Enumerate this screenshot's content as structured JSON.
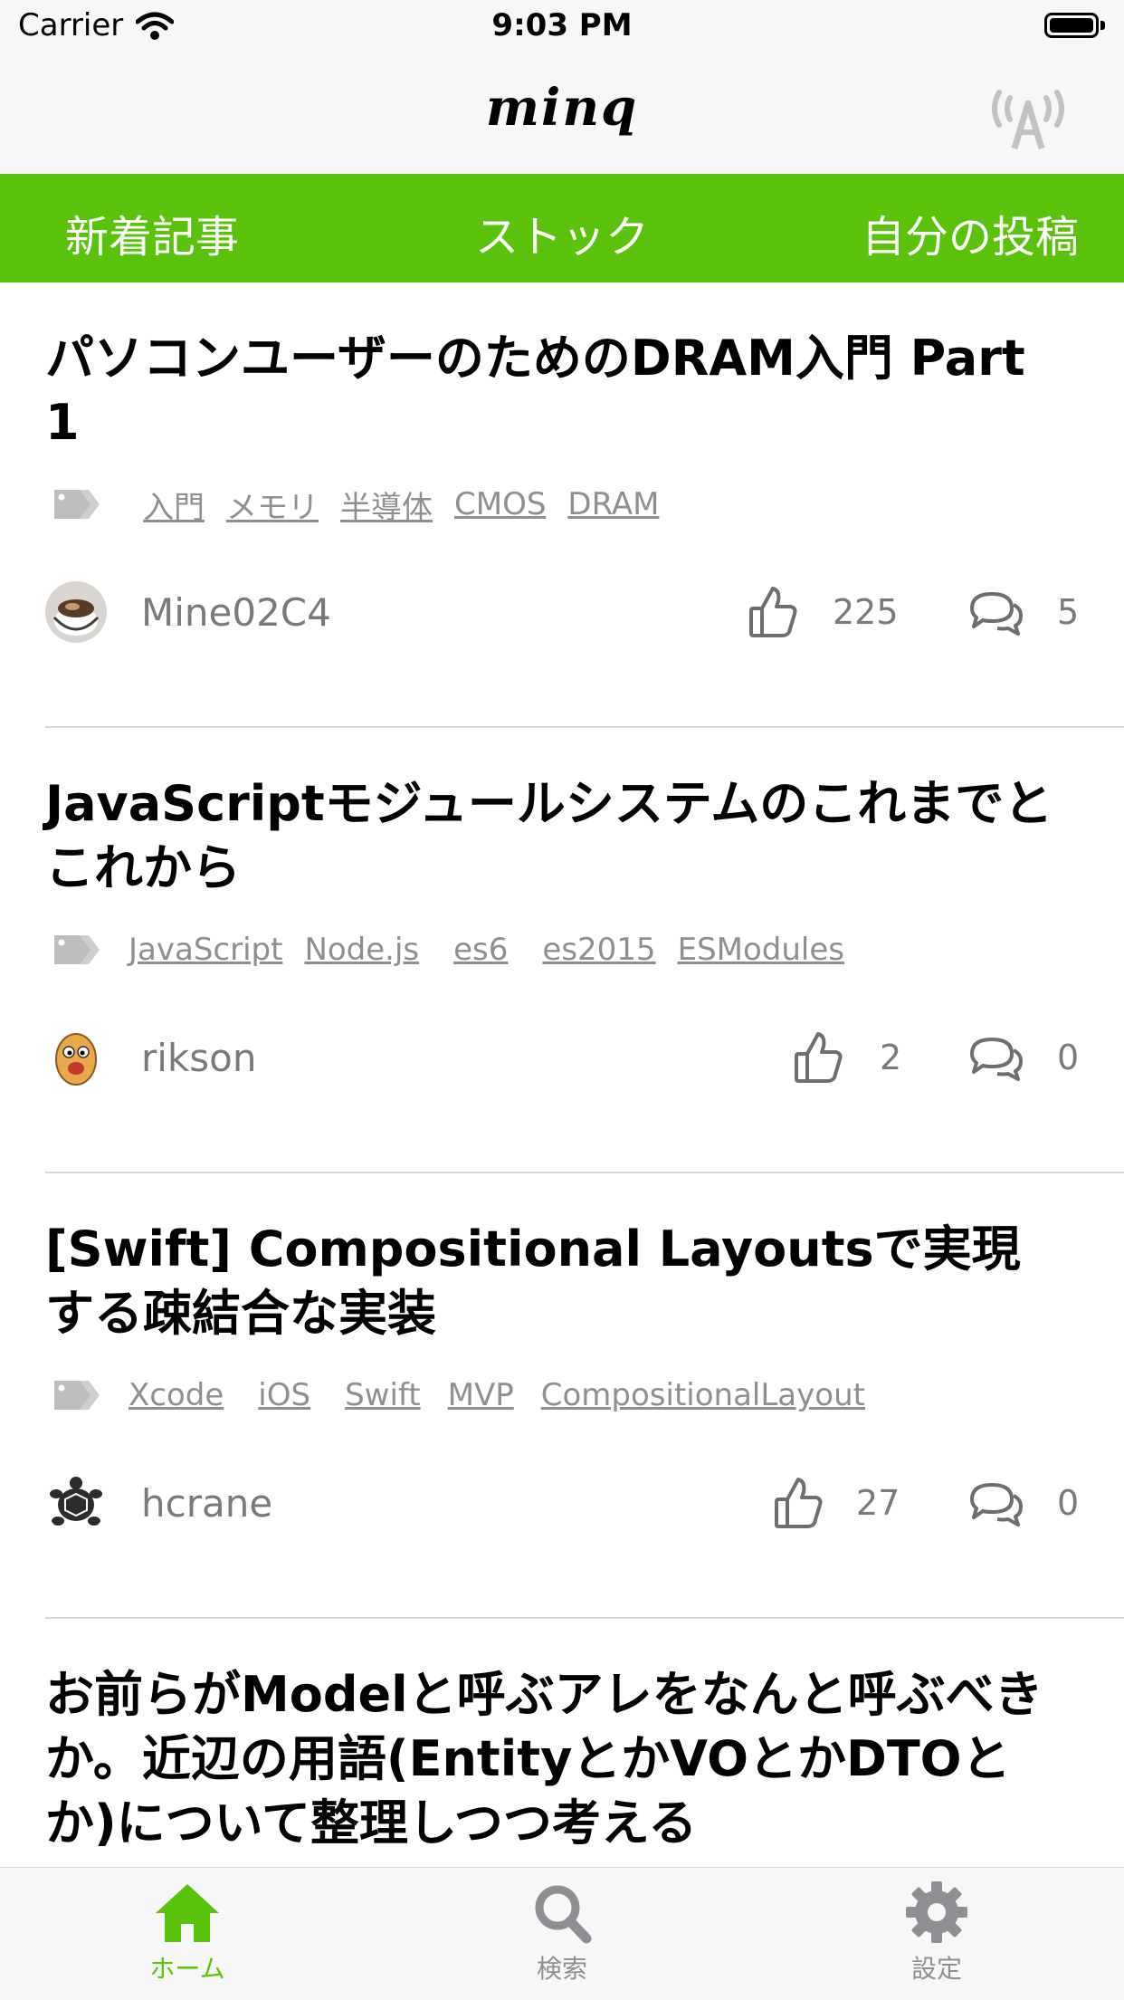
{
  "status_bar": {
    "carrier": "Carrier",
    "time": "9:03 PM"
  },
  "nav": {
    "logo": "minq"
  },
  "tabs": [
    {
      "label": "新着記事"
    },
    {
      "label": "ストック"
    },
    {
      "label": "自分の投稿"
    }
  ],
  "articles": [
    {
      "title": "パソコンユーザーのためのDRAM入門 Part 1",
      "tags": [
        "入門",
        "メモリ",
        "半導体",
        "CMOS",
        "DRAM"
      ],
      "author": "Mine02C4",
      "likes": "225",
      "comments": "5"
    },
    {
      "title": "JavaScriptモジュールシステムのこれまでとこれから",
      "tags": [
        "JavaScript",
        "Node.js",
        "es6",
        "es2015",
        "ESModules"
      ],
      "author": "rikson",
      "likes": "2",
      "comments": "0"
    },
    {
      "title": "[Swift] Compositional Layoutsで実現する疎結合な実装",
      "tags": [
        "Xcode",
        "iOS",
        "Swift",
        "MVP",
        "CompositionalLayout"
      ],
      "author": "hcrane",
      "likes": "27",
      "comments": "0"
    },
    {
      "title": "お前らがModelと呼ぶアレをなんと呼ぶべきか。近辺の用語(EntityとかVOとかDTOとか)について整理しつつ考える"
    }
  ],
  "bottom_tabs": [
    {
      "label": "ホーム",
      "icon": "home-icon"
    },
    {
      "label": "検索",
      "icon": "search-icon"
    },
    {
      "label": "設定",
      "icon": "gear-icon"
    }
  ],
  "colors": {
    "accent": "#5ac20a",
    "inactive": "#8e8e93"
  }
}
